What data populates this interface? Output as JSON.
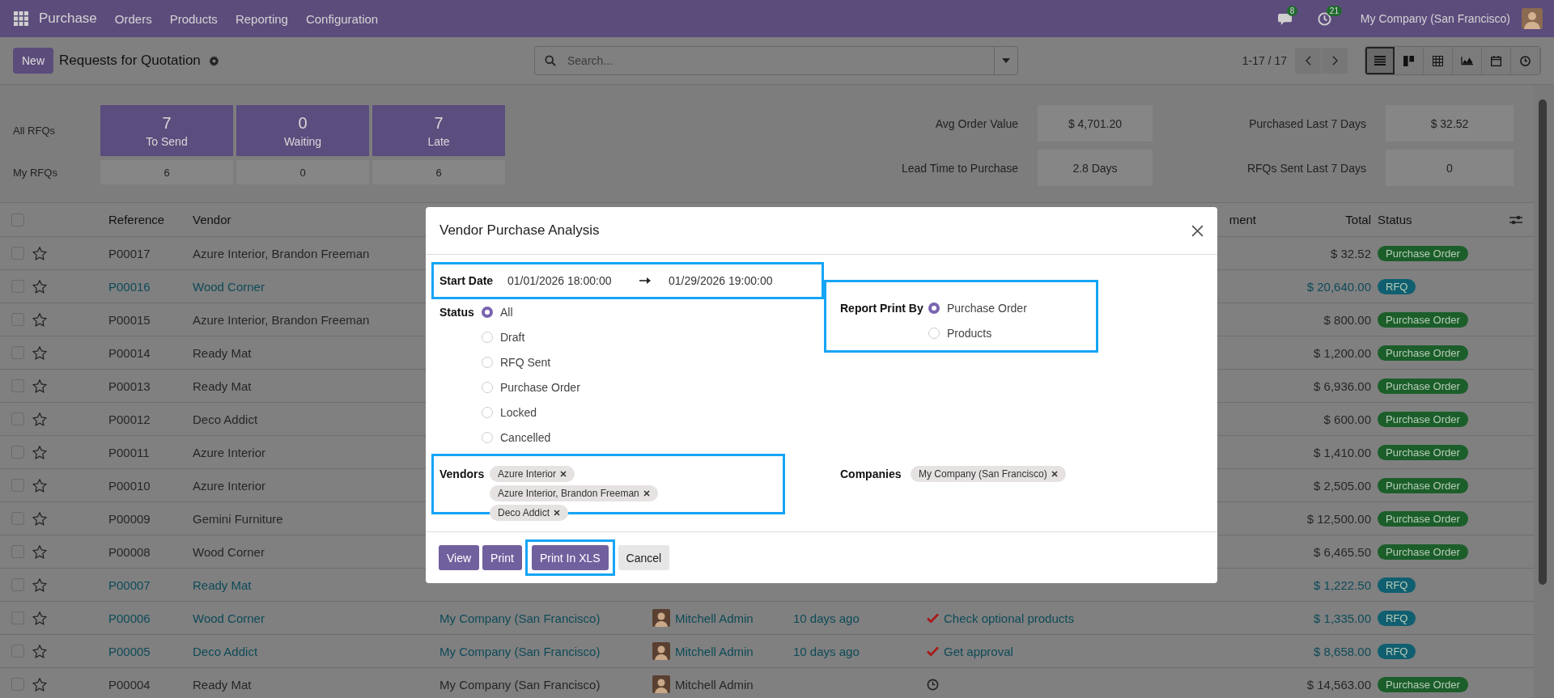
{
  "navbar": {
    "app": "Purchase",
    "menus": [
      "Orders",
      "Products",
      "Reporting",
      "Configuration"
    ],
    "messages_badge": "8",
    "activities_badge": "21",
    "company": "My Company (San Francisco)"
  },
  "control_panel": {
    "new_button": "New",
    "title": "Requests for Quotation",
    "search": {
      "placeholder": "Search..."
    },
    "pager": "1-17 / 17",
    "views": [
      {
        "kind": "list",
        "selected": true
      },
      {
        "kind": "kanban",
        "selected": false
      },
      {
        "kind": "pivot",
        "selected": false
      },
      {
        "kind": "graph",
        "selected": false
      },
      {
        "kind": "calendar",
        "selected": false
      },
      {
        "kind": "activity",
        "selected": false
      }
    ]
  },
  "dashboard": {
    "row_labels": [
      "All RFQs",
      "My RFQs"
    ],
    "tiles": [
      {
        "value": "7",
        "label": "To Send",
        "mine": "6"
      },
      {
        "value": "0",
        "label": "Waiting",
        "mine": "0"
      },
      {
        "value": "7",
        "label": "Late",
        "mine": "6"
      }
    ],
    "stats": [
      {
        "label": "Avg Order Value",
        "value": "$ 4,701.20"
      },
      {
        "label": "Purchased Last 7 Days",
        "value": "$ 32.52"
      },
      {
        "label": "Lead Time to Purchase",
        "value": "2.8 Days"
      },
      {
        "label": "RFQs Sent Last 7 Days",
        "value": "0"
      }
    ]
  },
  "table": {
    "header_checked": false,
    "columns": {
      "reference": "Reference",
      "vendor": "Vendor",
      "column_6": "ment",
      "total": "Total",
      "status": "Status"
    },
    "rows": [
      {
        "checked": false,
        "starred": false,
        "highlighted": false,
        "reference": "P00017",
        "vendor": "Azure Interior, Brandon Freeman",
        "total": "$ 32.52",
        "status": {
          "label": "Purchase Order",
          "color": "#1b5e2a"
        }
      },
      {
        "checked": false,
        "starred": false,
        "highlighted": true,
        "reference": "P00016",
        "vendor": "Wood Corner",
        "total": "$ 20,640.00",
        "status": {
          "label": "RFQ",
          "color": "#105f70"
        }
      },
      {
        "checked": false,
        "starred": false,
        "highlighted": false,
        "reference": "P00015",
        "vendor": "Azure Interior, Brandon Freeman",
        "total": "$ 800.00",
        "status": {
          "label": "Purchase Order",
          "color": "#1b5e2a"
        }
      },
      {
        "checked": false,
        "starred": false,
        "highlighted": false,
        "reference": "P00014",
        "vendor": "Ready Mat",
        "total": "$ 1,200.00",
        "status": {
          "label": "Purchase Order",
          "color": "#1b5e2a"
        }
      },
      {
        "checked": false,
        "starred": false,
        "highlighted": false,
        "reference": "P00013",
        "vendor": "Ready Mat",
        "total": "$ 6,936.00",
        "status": {
          "label": "Purchase Order",
          "color": "#1b5e2a"
        }
      },
      {
        "checked": false,
        "starred": false,
        "highlighted": false,
        "reference": "P00012",
        "vendor": "Deco Addict",
        "total": "$ 600.00",
        "status": {
          "label": "Purchase Order",
          "color": "#1b5e2a"
        }
      },
      {
        "checked": false,
        "starred": false,
        "highlighted": false,
        "reference": "P00011",
        "vendor": "Azure Interior",
        "total": "$ 1,410.00",
        "status": {
          "label": "Purchase Order",
          "color": "#1b5e2a"
        }
      },
      {
        "checked": false,
        "starred": false,
        "highlighted": false,
        "reference": "P00010",
        "vendor": "Azure Interior",
        "total": "$ 2,505.00",
        "status": {
          "label": "Purchase Order",
          "color": "#1b5e2a"
        }
      },
      {
        "checked": false,
        "starred": false,
        "highlighted": false,
        "reference": "P00009",
        "vendor": "Gemini Furniture",
        "total": "$ 12,500.00",
        "status": {
          "label": "Purchase Order",
          "color": "#1b5e2a"
        }
      },
      {
        "checked": false,
        "starred": false,
        "highlighted": false,
        "reference": "P00008",
        "vendor": "Wood Corner",
        "total": "$ 6,465.50",
        "status": {
          "label": "Purchase Order",
          "color": "#1b5e2a"
        }
      },
      {
        "checked": false,
        "starred": false,
        "highlighted": true,
        "reference": "P00007",
        "vendor": "Ready Mat",
        "total": "$ 1,222.50",
        "status": {
          "label": "RFQ",
          "color": "#105f70"
        }
      },
      {
        "checked": false,
        "starred": false,
        "highlighted": true,
        "reference": "P00006",
        "vendor": "Wood Corner",
        "company": "My Company (San Francisco)",
        "buyer": "Mitchell Admin",
        "deadline": "10 days ago",
        "activity": {
          "kind": "todo",
          "text": "Check optional products"
        },
        "total": "$ 1,335.00",
        "status": {
          "label": "RFQ",
          "color": "#105f70"
        }
      },
      {
        "checked": false,
        "starred": false,
        "highlighted": true,
        "reference": "P00005",
        "vendor": "Deco Addict",
        "company": "My Company (San Francisco)",
        "buyer": "Mitchell Admin",
        "deadline": "10 days ago",
        "activity": {
          "kind": "todo",
          "text": "Get approval"
        },
        "total": "$ 8,658.00",
        "status": {
          "label": "RFQ",
          "color": "#105f70"
        }
      },
      {
        "checked": false,
        "starred": false,
        "highlighted": false,
        "reference": "P00004",
        "vendor": "Ready Mat",
        "company": "My Company (San Francisco)",
        "buyer": "Mitchell Admin",
        "activity": {
          "kind": "clock"
        },
        "total": "$ 14,563.00",
        "status": {
          "label": "Purchase Order",
          "color": "#1b5e2a"
        }
      }
    ]
  },
  "dialog": {
    "title": "Vendor Purchase Analysis",
    "start_date": {
      "label": "Start Date",
      "from": "01/01/2026 18:00:00",
      "to": "01/29/2026 19:00:00",
      "highlighted": true
    },
    "status": {
      "label": "Status",
      "options": [
        {
          "label": "All",
          "selected": true
        },
        {
          "label": "Draft",
          "selected": false
        },
        {
          "label": "RFQ Sent",
          "selected": false
        },
        {
          "label": "Purchase Order",
          "selected": false
        },
        {
          "label": "Locked",
          "selected": false
        },
        {
          "label": "Cancelled",
          "selected": false
        }
      ]
    },
    "report_print_by": {
      "label": "Report Print By",
      "highlighted": true,
      "options": [
        {
          "label": "Purchase Order",
          "selected": true
        },
        {
          "label": "Products",
          "selected": false
        }
      ]
    },
    "vendors": {
      "label": "Vendors",
      "highlighted": true,
      "tags": [
        "Azure Interior",
        "Azure Interior, Brandon Freeman",
        "Deco Addict"
      ]
    },
    "companies": {
      "label": "Companies",
      "highlighted": false,
      "tags": [
        "My Company (San Francisco)"
      ]
    },
    "buttons": [
      {
        "label": "View",
        "kind": "primary",
        "highlighted": false
      },
      {
        "label": "Print",
        "kind": "primary",
        "highlighted": false
      },
      {
        "label": "Print In XLS",
        "kind": "primary",
        "highlighted": true
      },
      {
        "label": "Cancel",
        "kind": "secondary",
        "highlighted": false
      }
    ]
  }
}
